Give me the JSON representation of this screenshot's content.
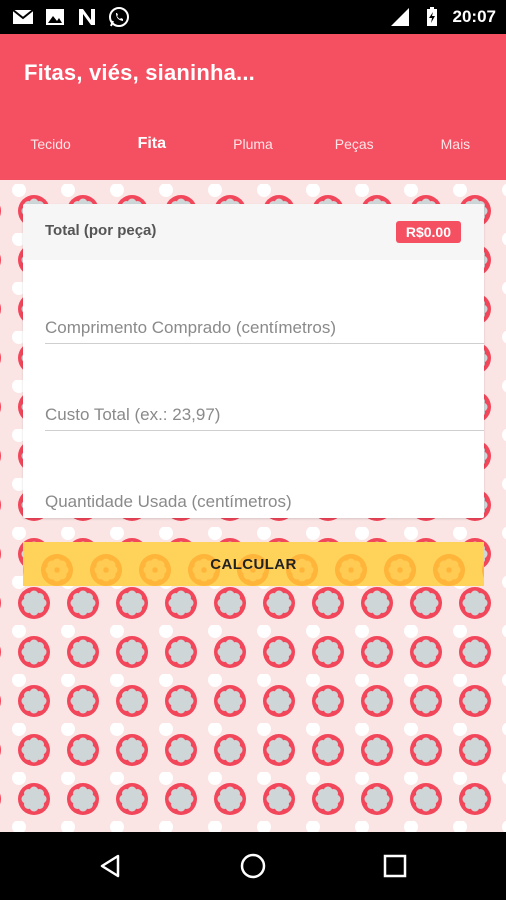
{
  "status_bar": {
    "time": "20:07",
    "icons": [
      "gmail-icon",
      "gallery-icon",
      "n-icon",
      "whatsapp-icon",
      "signal-icon",
      "battery-charging-icon"
    ]
  },
  "app": {
    "title": "Fitas, viés, sianinha...",
    "tabs": [
      {
        "label": "Tecido",
        "active": false
      },
      {
        "label": "Fita",
        "active": true
      },
      {
        "label": "Pluma",
        "active": false
      },
      {
        "label": "Peças",
        "active": false
      },
      {
        "label": "Mais",
        "active": false
      }
    ]
  },
  "card": {
    "total_label": "Total (por peça)",
    "total_value": "R$0.00",
    "fields": [
      {
        "placeholder": "Comprimento Comprado (centímetros)",
        "value": ""
      },
      {
        "placeholder": "Custo Total (ex.: 23,97)",
        "value": ""
      },
      {
        "placeholder": "Quantidade Usada (centímetros)",
        "value": ""
      }
    ]
  },
  "calculate_button": {
    "label": "CALCULAR"
  },
  "nav": {
    "icons": [
      "back-icon",
      "home-icon",
      "recents-icon"
    ]
  },
  "colors": {
    "primary": "#f54f62",
    "accent": "#ffd35a",
    "background": "#fbe4e4"
  }
}
